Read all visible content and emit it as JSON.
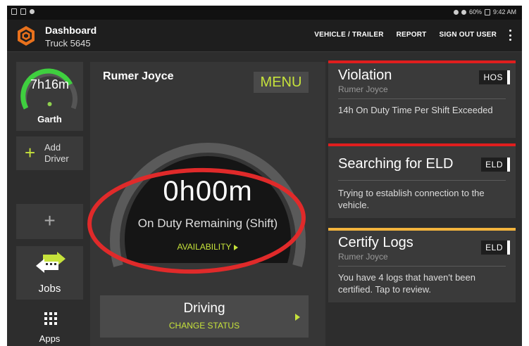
{
  "statusbar": {
    "time": "9:42 AM",
    "battery": "60%"
  },
  "header": {
    "title": "Dashboard",
    "subtitle": "Truck 5645",
    "nav": [
      {
        "label": "VEHICLE / TRAILER"
      },
      {
        "label": "REPORT"
      },
      {
        "label": "SIGN OUT USER"
      }
    ]
  },
  "sidebar": {
    "driver_card": {
      "time": "7h16m",
      "name": "Garth"
    },
    "add_driver": {
      "label_line1": "Add",
      "label_line2": "Driver"
    },
    "jobs_label": "Jobs",
    "apps_label": "Apps"
  },
  "main": {
    "driver_name": "Rumer Joyce",
    "menu_label": "MENU",
    "remaining_time": "0h00m",
    "remaining_label": "On Duty Remaining (Shift)",
    "availability_label": "AVAILABILITY",
    "status": {
      "label": "Driving",
      "action": "CHANGE STATUS"
    }
  },
  "alerts": [
    {
      "title": "Violation",
      "person": "Rumer Joyce",
      "tag": "HOS",
      "body": "14h On Duty Time Per Shift Exceeded",
      "bar_color": "#e01e1e"
    },
    {
      "title": "Searching for ELD",
      "person": "",
      "tag": "ELD",
      "body": "Trying to establish connection to the vehicle.",
      "bar_color": "#e01e1e"
    },
    {
      "title": "Certify Logs",
      "person": "Rumer Joyce",
      "tag": "ELD",
      "body": "You have 4 logs that haven't been certified. Tap to review.",
      "bar_color": "#f2b33d"
    }
  ],
  "colors": {
    "accent": "#c6e23b",
    "gauge_green": "#3fcf3f",
    "highlight_red": "#e02a2a"
  }
}
